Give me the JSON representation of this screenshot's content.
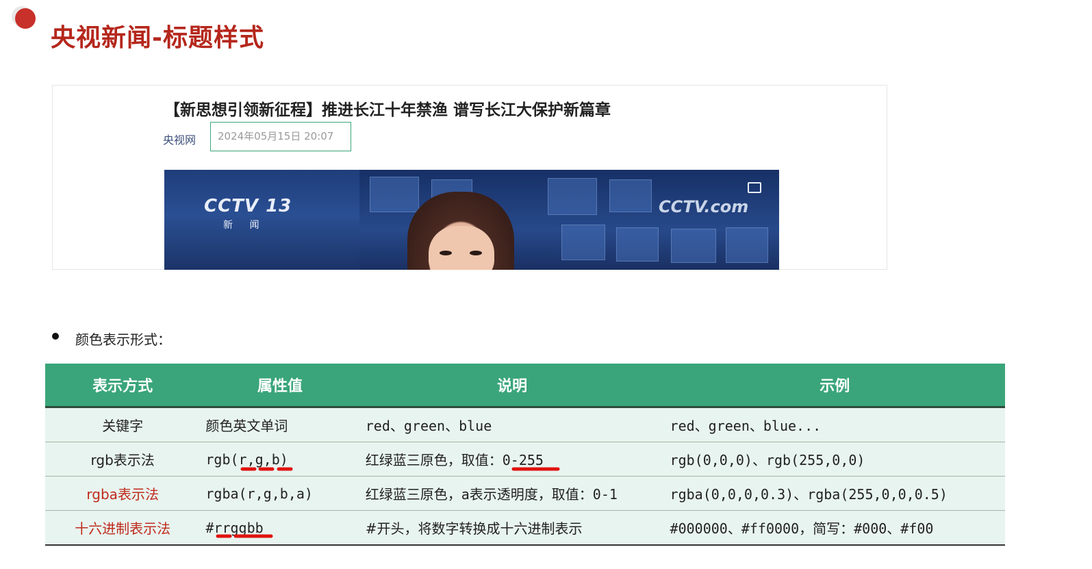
{
  "slide": {
    "title": "央视新闻-标题样式"
  },
  "news": {
    "headline": "【新思想引领新征程】推进长江十年禁渔 谱写长江大保护新篇章",
    "source": "央视网",
    "date": "2024年05月15日 20:07",
    "video_brand_left": "CCTV 13",
    "video_brand_left_sub": "新 闻",
    "video_brand_right": "CCTV.com"
  },
  "bullet": {
    "text": "颜色表示形式："
  },
  "table": {
    "headers": [
      "表示方式",
      "属性值",
      "说明",
      "示例"
    ],
    "rows": [
      {
        "method": "关键字",
        "value": "颜色英文单词",
        "desc": "red、green、blue",
        "example": "red、green、blue..."
      },
      {
        "method": "rgb表示法",
        "value": "rgb(r,g,b)",
        "desc": "红绿蓝三原色，取值：0-255",
        "example": "rgb(0,0,0)、rgb(255,0,0)"
      },
      {
        "method": "rgba表示法",
        "value": "rgba(r,g,b,a)",
        "desc": "红绿蓝三原色，a表示透明度，取值：0-1",
        "example": "rgba(0,0,0,0.3)、rgba(255,0,0,0.5)"
      },
      {
        "method": "十六进制表示法",
        "value": "#rrggbb",
        "desc": "#开头，将数字转换成十六进制表示",
        "example": "#000000、#ff0000，简写：#000、#f00"
      }
    ]
  },
  "colors": {
    "title_red": "#b5271c",
    "table_header_green": "#3aa57a",
    "table_row_bg": "#e8f4ef",
    "annotation_red": "#e0130f"
  }
}
